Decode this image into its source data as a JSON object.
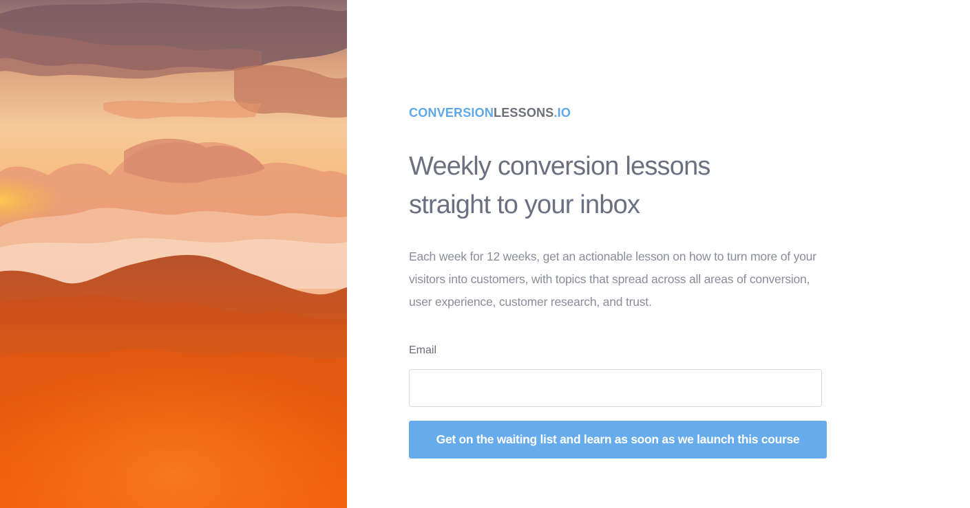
{
  "colors": {
    "brand_blue": "#5fa8e8",
    "brand_gray": "#6e7079",
    "headline": "#6c6f80",
    "body_text": "#8a8d99",
    "button_bg": "#66acec",
    "button_text": "#ffffff"
  },
  "hero": {
    "image": "sunset-mountains-photo"
  },
  "logo": {
    "part1": "CONVERSION",
    "part2": "LESSONS",
    "part3": ".IO"
  },
  "headline": {
    "line1": "Weekly conversion lessons",
    "line2": "straight to your inbox"
  },
  "description": "Each week for 12 weeks, get an actionable lesson on how to turn more of your visitors into customers, with topics that spread across all areas of conversion, user experience, customer research, and trust.",
  "form": {
    "email_label": "Email",
    "email_value": "",
    "email_placeholder": "",
    "submit_label": "Get on the waiting list and learn as soon as we launch this course"
  }
}
